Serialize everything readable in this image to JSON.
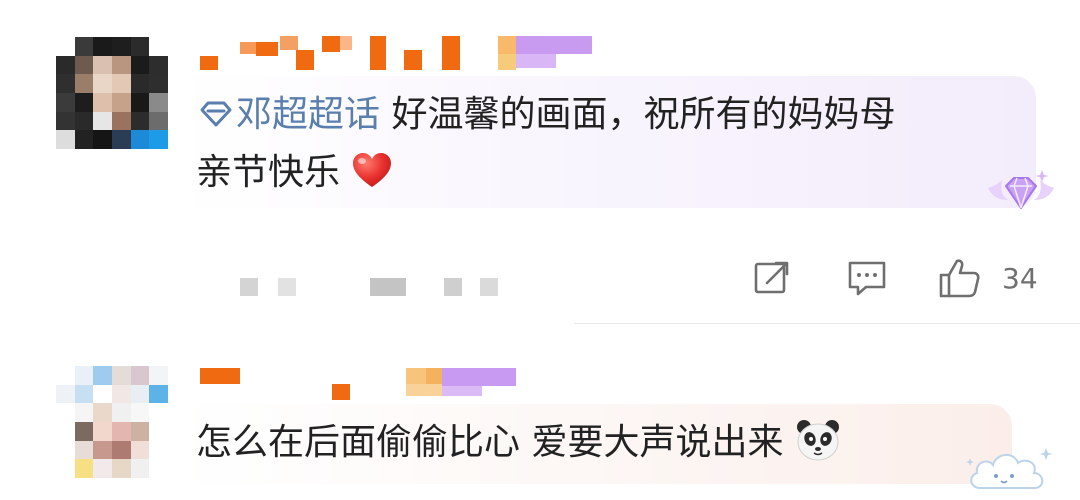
{
  "comments": [
    {
      "topic": "邓超超话",
      "text": "好温馨的画面，祝所有的妈妈母",
      "text_line2": "亲节快乐",
      "emoji": "heart",
      "badge": "diamond-fan-badge-icon",
      "actions": {
        "repost_icon": "share-edit-icon",
        "reply_icon": "comment-icon",
        "like_icon": "thumbs-up-icon",
        "like_count": "34"
      }
    },
    {
      "text": "怎么在后面偷偷比心 爱要大声说出来",
      "emoji": "panda",
      "badge": "cloud-sticker-icon"
    }
  ],
  "colors": {
    "topic_link": "#5a7fae",
    "text": "#222222",
    "action_icon": "#6f6f6f",
    "bubble_tint": "#f3ecfb",
    "heart": "#e8312e",
    "badge": "#c9a2f5"
  }
}
